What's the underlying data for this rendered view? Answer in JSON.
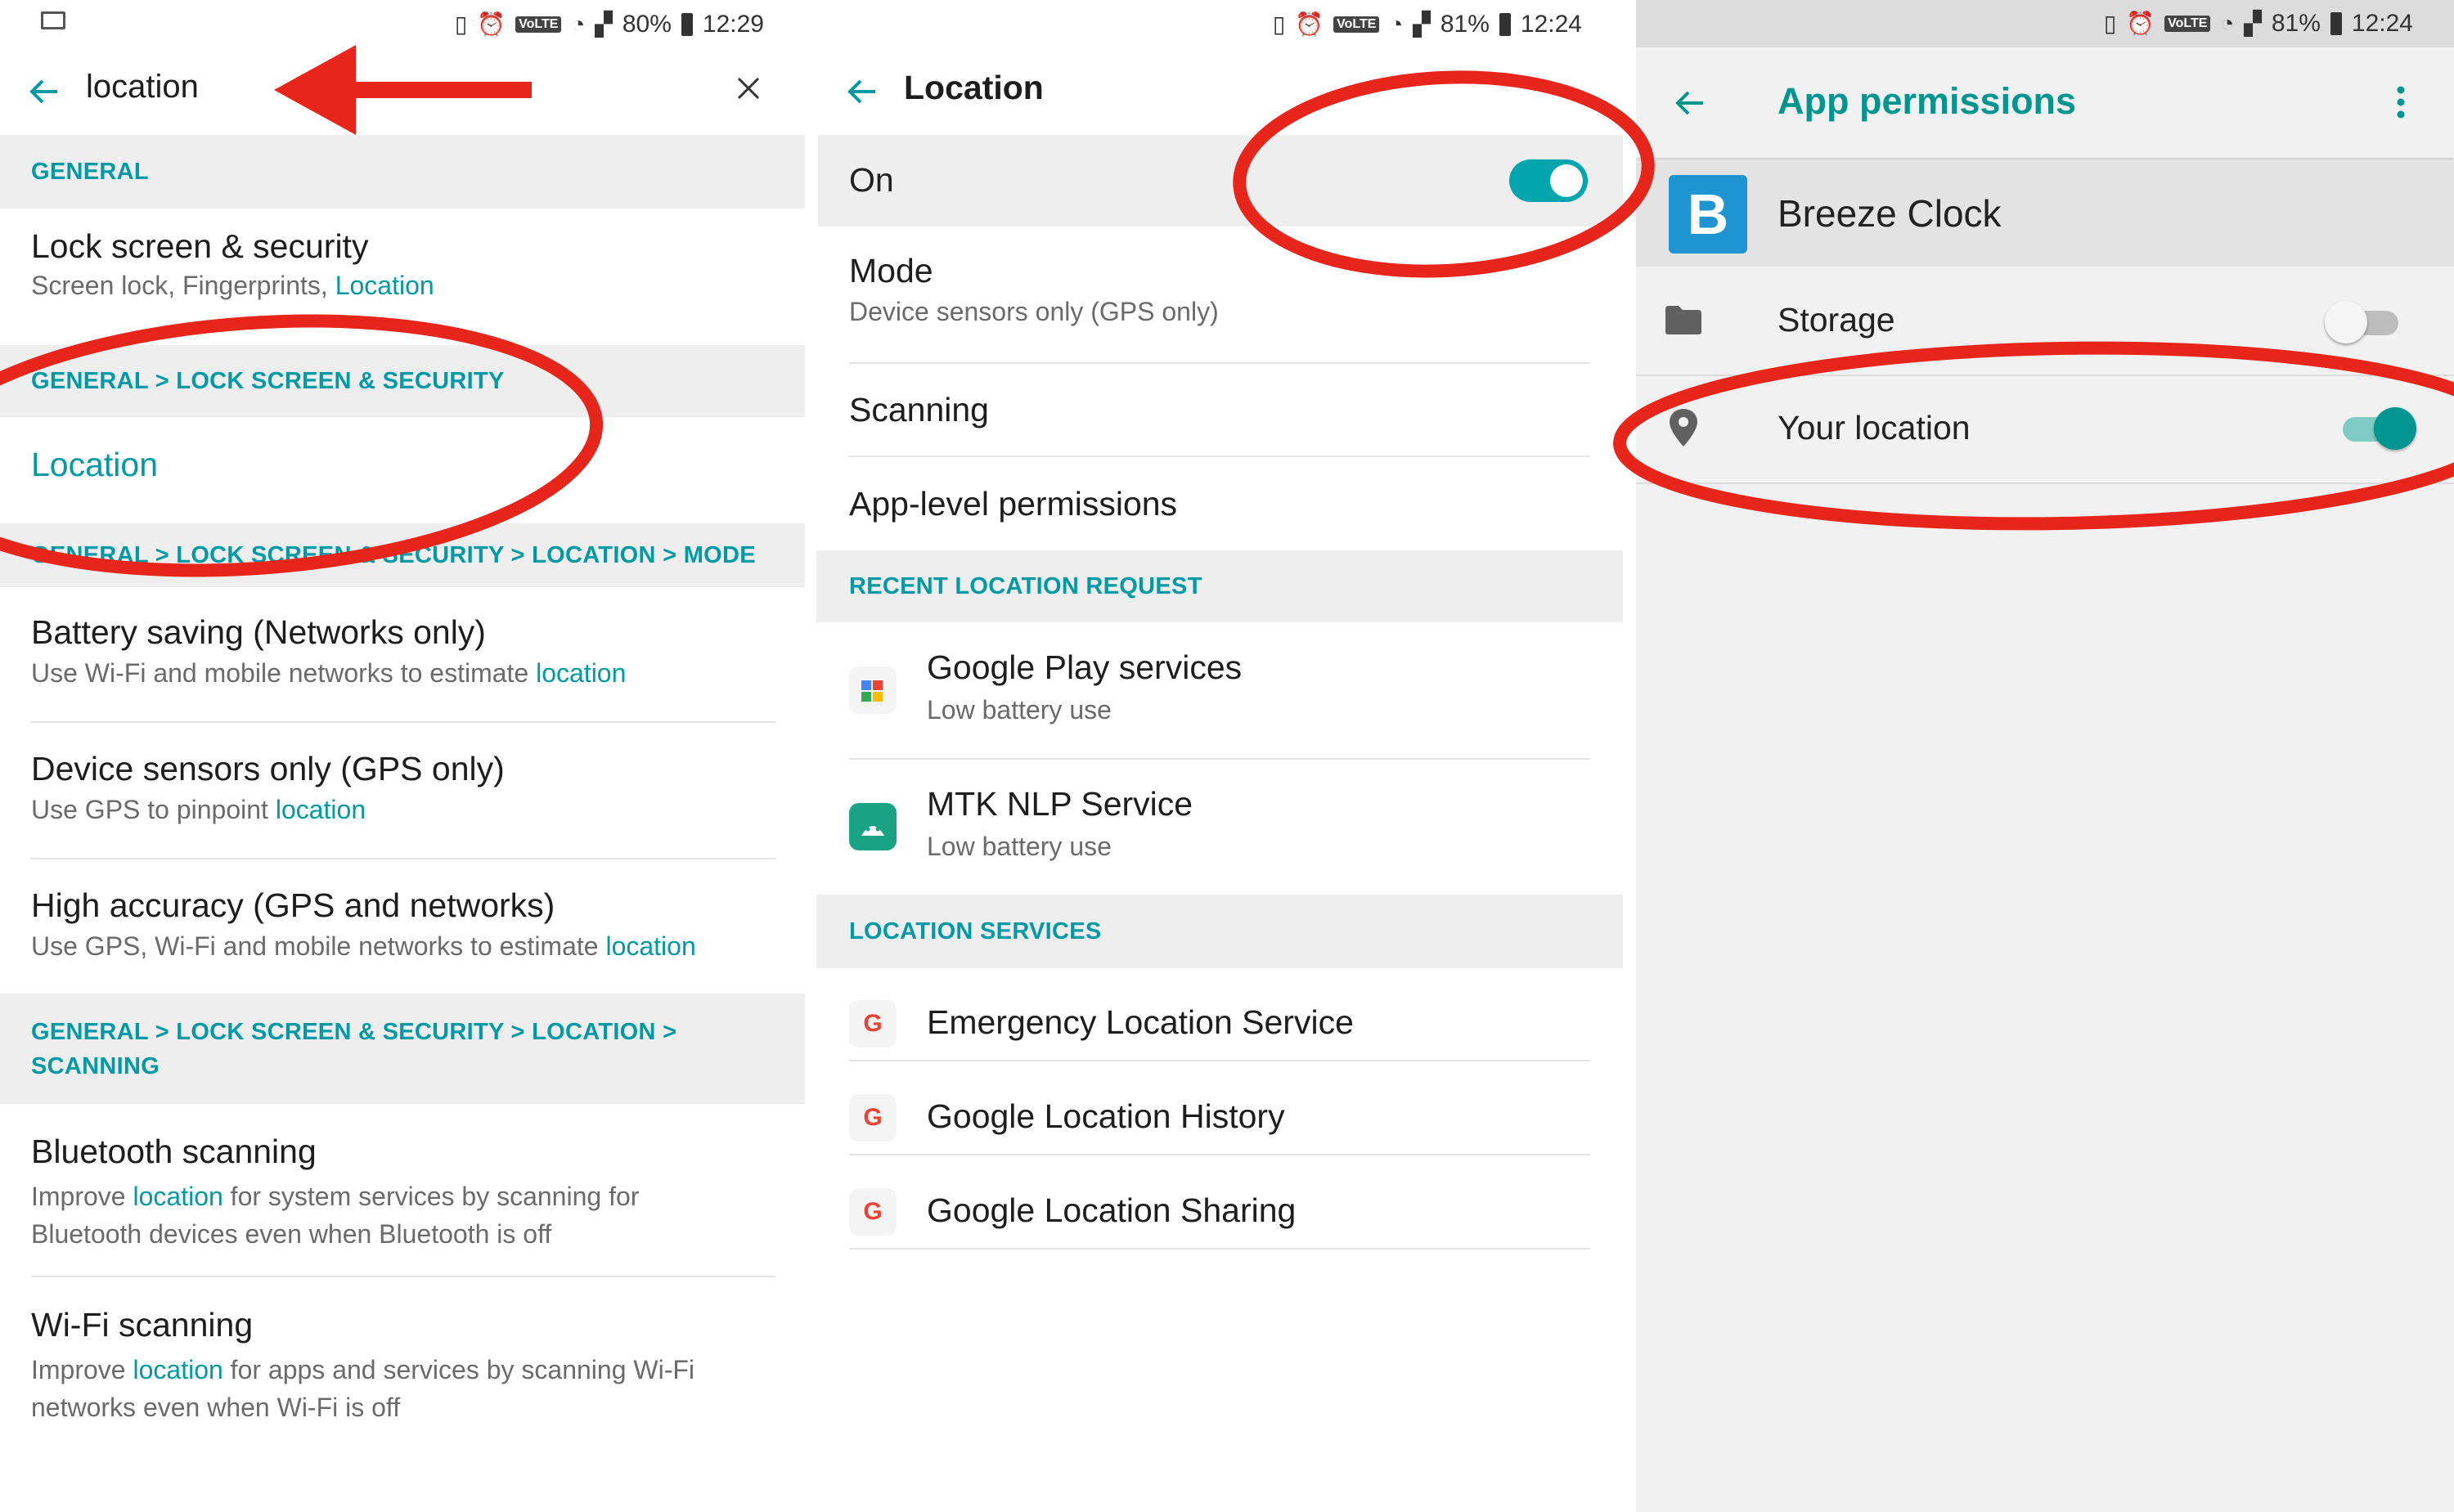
{
  "panel1": {
    "status": {
      "battery": "80%",
      "time": "12:29",
      "network": "4G"
    },
    "search": {
      "query": "location"
    },
    "sections": {
      "general": "GENERAL",
      "lock_security": "GENERAL > LOCK SCREEN & SECURITY",
      "mode": "GENERAL > LOCK SCREEN & SECURITY > LOCATION > MODE",
      "scanning_line1": "GENERAL > LOCK SCREEN & SECURITY > LOCATION >",
      "scanning_line2": "SCANNING"
    },
    "items": {
      "lock_title": "Lock screen & security",
      "lock_sub_plain": "Screen lock, Fingerprints, ",
      "lock_sub_hl": "Location",
      "location_result": "Location",
      "battery_title": "Battery saving (Networks only)",
      "battery_sub_plain": "Use Wi-Fi and mobile networks to estimate ",
      "battery_sub_hl": "location",
      "device_title": "Device sensors only (GPS only)",
      "device_sub_plain": "Use GPS to pinpoint ",
      "device_sub_hl": "location",
      "high_title": "High accuracy (GPS and networks)",
      "high_sub_plain": "Use GPS, Wi-Fi and mobile networks to estimate ",
      "high_sub_hl": "location",
      "bt_title": "Bluetooth scanning",
      "bt_sub_a": "Improve ",
      "bt_sub_hl": "location",
      "bt_sub_b": " for system services by scanning for",
      "bt_sub_c": "Bluetooth devices even when Bluetooth is off",
      "wifi_title": "Wi-Fi scanning",
      "wifi_sub_a": "Improve ",
      "wifi_sub_hl": "location",
      "wifi_sub_b": " for apps and services by scanning Wi-Fi",
      "wifi_sub_c": "networks even when Wi-Fi is off"
    }
  },
  "panel2": {
    "status": {
      "battery": "81%",
      "time": "12:24",
      "network": "4G"
    },
    "title": "Location",
    "master": {
      "label": "On",
      "state": true
    },
    "mode": {
      "title": "Mode",
      "sub": "Device sensors only (GPS only)"
    },
    "scanning": "Scanning",
    "app_level": "App-level permissions",
    "recent_header": "RECENT LOCATION REQUEST",
    "recent": [
      {
        "name": "Google Play services",
        "sub": "Low battery use"
      },
      {
        "name": "MTK NLP Service",
        "sub": "Low battery use"
      }
    ],
    "services_header": "LOCATION SERVICES",
    "services": [
      {
        "name": "Emergency Location Service"
      },
      {
        "name": "Google Location History"
      },
      {
        "name": "Google Location Sharing"
      }
    ]
  },
  "panel3": {
    "status": {
      "battery": "81%",
      "time": "12:24",
      "network": "4G"
    },
    "title": "App permissions",
    "app": {
      "name": "Breeze Clock",
      "icon_letter": "B"
    },
    "permissions": [
      {
        "name": "Storage",
        "enabled": false
      },
      {
        "name": "Your location",
        "enabled": true
      }
    ]
  },
  "colors": {
    "accent": "#009aa6",
    "annotation": "#e8251a",
    "toggle_on_thumb": "#00968f",
    "section_bg": "#eeeeee"
  },
  "icons": [
    "back-arrow-icon",
    "close-icon",
    "overflow-menu-icon",
    "folder-icon",
    "location-pin-icon",
    "google-g-icon",
    "android-icon",
    "puzzle-icon"
  ]
}
